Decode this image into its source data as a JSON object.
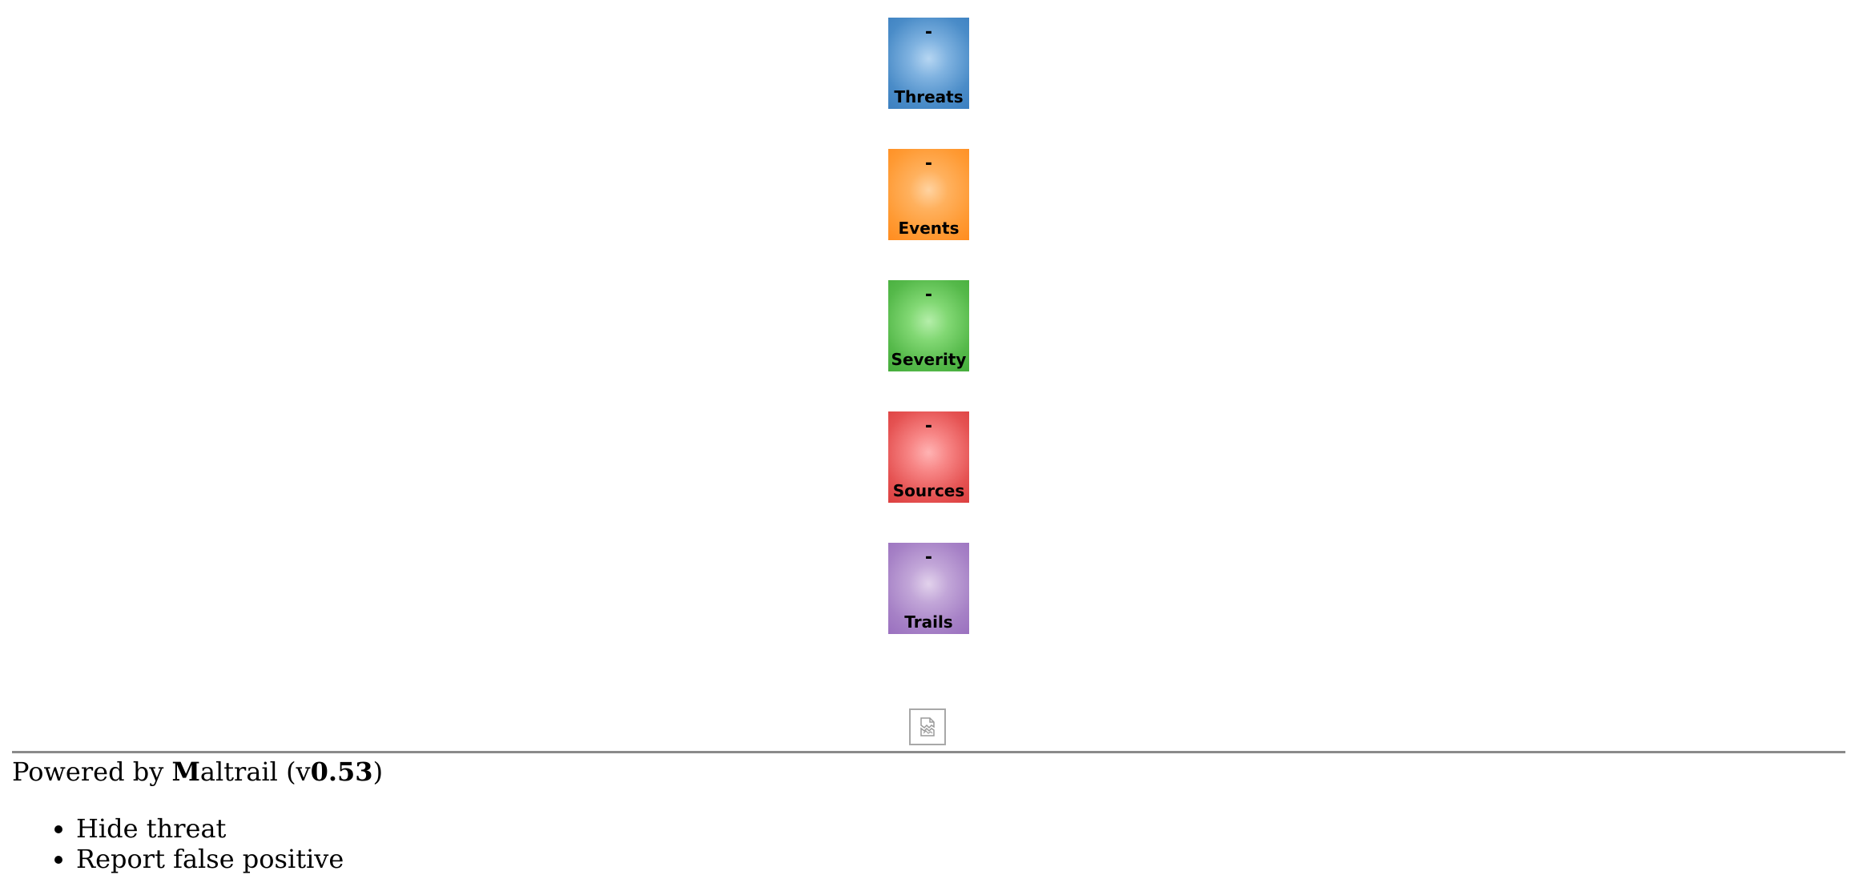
{
  "counters": [
    {
      "label": "Threats",
      "value": "-",
      "color": "#3b7fc0"
    },
    {
      "label": "Events",
      "value": "-",
      "color": "#ff8c1f"
    },
    {
      "label": "Severity",
      "value": "-",
      "color": "#45ad3b"
    },
    {
      "label": "Sources",
      "value": "-",
      "color": "#dc3f3f"
    },
    {
      "label": "Trails",
      "value": "-",
      "color": "#9a70bf"
    }
  ],
  "chart_placeholder": {
    "icon": "broken-image-icon"
  },
  "footer": {
    "prefix": "Powered by ",
    "brand_initial": "M",
    "brand_rest": "altrail",
    "version_open": " (v",
    "version": "0.53",
    "version_close": ")"
  },
  "context_menu": {
    "items": [
      "Hide threat",
      "Report false positive"
    ]
  }
}
